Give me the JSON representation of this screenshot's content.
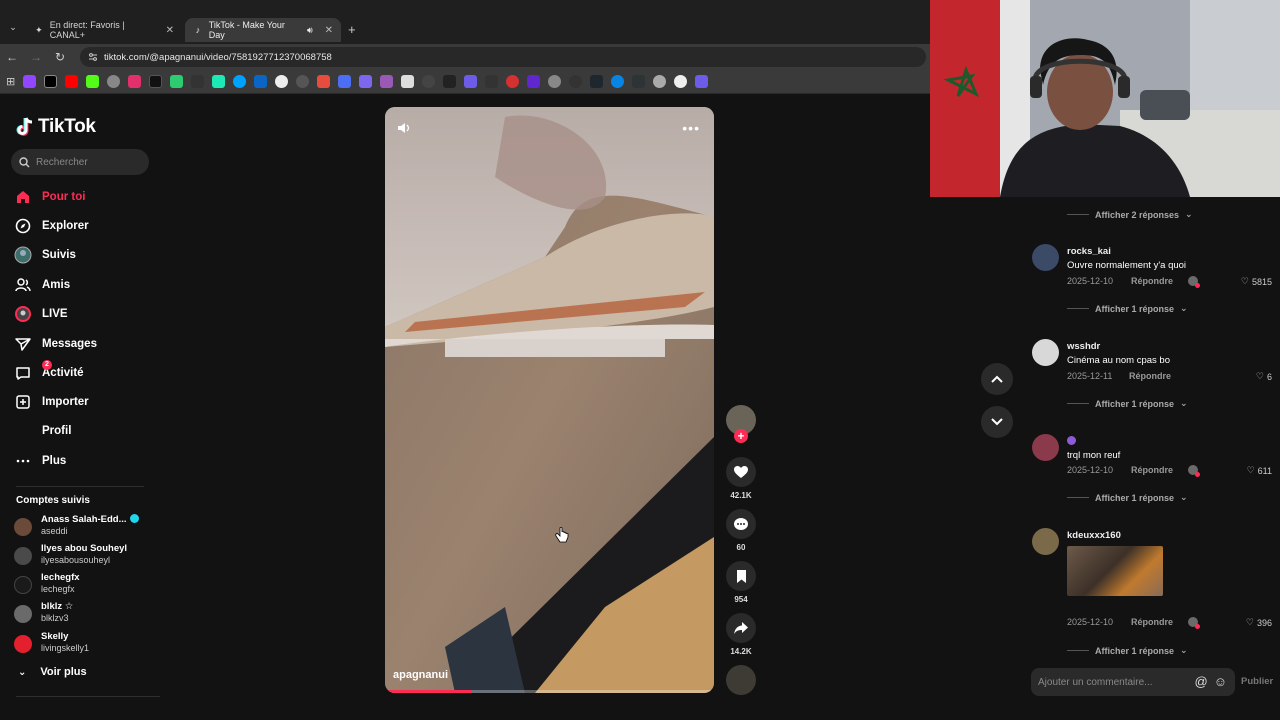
{
  "browser": {
    "tabs": [
      {
        "title": "En direct: Favoris | CANAL+",
        "active": false
      },
      {
        "title": "TikTok - Make Your Day",
        "active": true
      }
    ],
    "url": "tiktok.com/@apagnanui/video/7581927712370068758"
  },
  "sidebar": {
    "logo_text": "TikTok",
    "search_placeholder": "Rechercher",
    "nav": [
      {
        "label": "Pour toi",
        "icon": "home-icon",
        "active": true
      },
      {
        "label": "Explorer",
        "icon": "compass-icon"
      },
      {
        "label": "Suivis",
        "icon": "following-avatar-icon"
      },
      {
        "label": "Amis",
        "icon": "friends-icon"
      },
      {
        "label": "LIVE",
        "icon": "live-icon"
      },
      {
        "label": "Messages",
        "icon": "send-icon"
      },
      {
        "label": "Activité",
        "icon": "inbox-icon",
        "badge": "2"
      },
      {
        "label": "Importer",
        "icon": "upload-icon"
      },
      {
        "label": "Profil",
        "icon": "profile-icon"
      },
      {
        "label": "Plus",
        "icon": "more-icon"
      }
    ],
    "followed_title": "Comptes suivis",
    "followed": [
      {
        "name": "Anass Salah-Edd...",
        "username": "aseddi",
        "verified": true
      },
      {
        "name": "Ilyes abou Souheyl",
        "username": "ilyesabousouheyl"
      },
      {
        "name": "lechegfx",
        "username": "lechegfx"
      },
      {
        "name": "blklz ☆",
        "username": "blklzv3"
      },
      {
        "name": "Skelly",
        "username": "livingskelly1"
      }
    ],
    "see_more": "Voir plus"
  },
  "video": {
    "username": "apagnanui",
    "progress": 0.26
  },
  "actions": {
    "likes": "42.1K",
    "comments": "60",
    "saves": "954",
    "shares": "14.2K"
  },
  "comments": [
    {
      "type": "replies",
      "label": "Afficher 2 réponses"
    },
    {
      "user": "rocks_kai",
      "text": "Ouvre normalement y'a quoi",
      "date": "2025-12-10",
      "reply": "Répondre",
      "likes": "5815",
      "replies": "Afficher 1 réponse"
    },
    {
      "user": "wsshdr",
      "text": "Cinéma au nom cpas bo",
      "date": "2025-12-11",
      "reply": "Répondre",
      "likes": "6",
      "replies": "Afficher 1 réponse"
    },
    {
      "user": "",
      "text": "trql mon reuf",
      "date": "2025-12-10",
      "reply": "Répondre",
      "likes": "611",
      "replies": "Afficher 1 réponse"
    },
    {
      "user": "kdeuxxx160",
      "text": "",
      "date": "2025-12-10",
      "reply": "Répondre",
      "likes": "396",
      "replies": "Afficher 1 réponse"
    }
  ],
  "comment_input": {
    "placeholder": "Ajouter un commentaire...",
    "publish": "Publier"
  },
  "colors": {
    "accent": "#fe2c55",
    "background": "#121212"
  }
}
